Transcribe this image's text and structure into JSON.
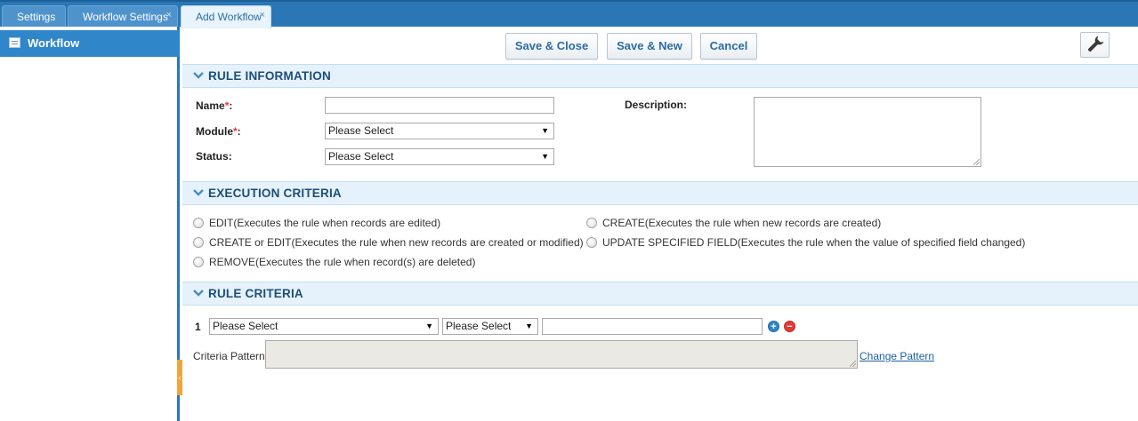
{
  "tabs": [
    {
      "label": "Settings",
      "closable": false,
      "active": false
    },
    {
      "label": "Workflow Settings",
      "closable": true,
      "active": false
    },
    {
      "label": "Add Workflow",
      "closable": true,
      "active": true
    }
  ],
  "tab_close_symbol": "×",
  "sidebar": {
    "items": [
      {
        "label": "Workflow",
        "icon": "list-icon",
        "active": true
      }
    ]
  },
  "toolbar": {
    "save_close_label": "Save & Close",
    "save_new_label": "Save & New",
    "cancel_label": "Cancel",
    "settings_icon": "wrench-icon"
  },
  "rule_information": {
    "title": "RULE INFORMATION",
    "name_label": "Name",
    "module_label": "Module",
    "status_label": "Status",
    "description_label": "Description:",
    "required_mark": "*",
    "label_colon": ":",
    "name_value": "",
    "module_value": "Please Select",
    "status_value": "Please Select",
    "description_value": ""
  },
  "execution_criteria": {
    "title": "EXECUTION CRITERIA",
    "options": [
      "EDIT(Executes the rule when records are edited)",
      "CREATE(Executes the rule when new records are created)",
      "CREATE or EDIT(Executes the rule when new records are created or modified)",
      "UPDATE SPECIFIED FIELD(Executes the rule when the value of specified field changed)",
      "REMOVE(Executes the rule when record(s) are deleted)"
    ]
  },
  "rule_criteria": {
    "title": "RULE CRITERIA",
    "rows": [
      {
        "number": "1",
        "field": "Please Select",
        "operator": "Please Select",
        "value": ""
      }
    ],
    "add_symbol": "+",
    "remove_symbol": "−",
    "criteria_pattern_label": "Criteria Pattern",
    "criteria_pattern_value": "",
    "change_pattern_label": "Change Pattern"
  },
  "colors": {
    "tabbar": "#2b77b6",
    "sidebar_active": "#2f86c8",
    "section_header_bg": "#e6f2fb",
    "section_title": "#1d4e78",
    "required": "#e53935",
    "add_button": "#2f86c8",
    "remove_button": "#e53935"
  }
}
